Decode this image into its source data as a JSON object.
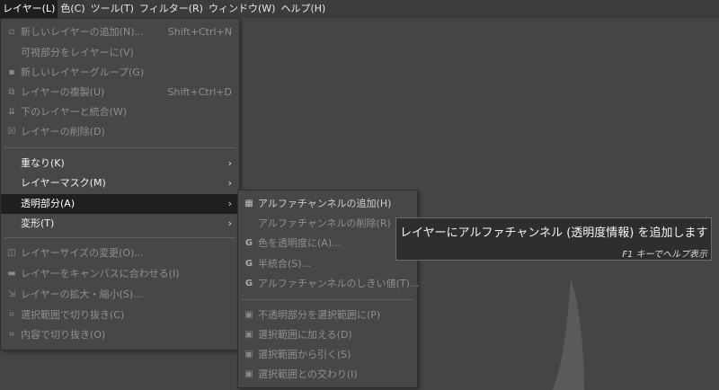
{
  "menubar": [
    {
      "label": "レイヤー(L)",
      "active": true
    },
    {
      "label": "色(C)"
    },
    {
      "label": "ツール(T)"
    },
    {
      "label": "フィルター(R)"
    },
    {
      "label": "ウィンドウ(W)"
    },
    {
      "label": "ヘルプ(H)"
    }
  ],
  "layer_menu": {
    "new_layer": {
      "label": "新しいレイヤーの追加(N)...",
      "shortcut": "Shift+Ctrl+N",
      "icon": "new-layer-icon"
    },
    "new_from_visible": {
      "label": "可視部分をレイヤーに(V)"
    },
    "new_layer_group": {
      "label": "新しいレイヤーグループ(G)",
      "icon": "folder-icon"
    },
    "duplicate": {
      "label": "レイヤーの複製(U)",
      "shortcut": "Shift+Ctrl+D",
      "icon": "duplicate-icon"
    },
    "merge_down": {
      "label": "下のレイヤーと統合(W)",
      "icon": "merge-down-icon"
    },
    "delete": {
      "label": "レイヤーの削除(D)",
      "icon": "delete-icon"
    },
    "stack": {
      "label": "重なり(K)"
    },
    "mask": {
      "label": "レイヤーマスク(M)"
    },
    "transparency": {
      "label": "透明部分(A)"
    },
    "transform": {
      "label": "変形(T)"
    },
    "boundary_size": {
      "label": "レイヤーサイズの変更(O)...",
      "icon": "resize-icon"
    },
    "layer_to_image": {
      "label": "レイヤーをキャンバスに合わせる(I)",
      "icon": "fit-canvas-icon"
    },
    "scale": {
      "label": "レイヤーの拡大・縮小(S)...",
      "icon": "scale-icon"
    },
    "crop_to_selection": {
      "label": "選択範囲で切り抜き(C)",
      "icon": "crop-icon"
    },
    "crop_to_content": {
      "label": "内容で切り抜き(O)",
      "icon": "crop-content-icon"
    }
  },
  "transparency_menu": {
    "add_alpha": {
      "label": "アルファチャンネルの追加(H)",
      "icon": "checker-icon"
    },
    "remove_alpha": {
      "label": "アルファチャンネルの削除(R)"
    },
    "color_to_alpha": {
      "label": "色を透明度に(A)...",
      "icon": "gegl-icon"
    },
    "semi_flatten": {
      "label": "半統合(S)...",
      "icon": "gegl-icon"
    },
    "threshold_alpha": {
      "label": "アルファチャンネルのしきい値(T)...",
      "icon": "gegl-icon"
    },
    "alpha_to_selection": {
      "label": "不透明部分を選択範囲に(P)",
      "icon": "selection-icon"
    },
    "add_to_selection": {
      "label": "選択範囲に加える(D)",
      "icon": "selection-add-icon"
    },
    "subtract_from_selection": {
      "label": "選択範囲から引く(S)",
      "icon": "selection-subtract-icon"
    },
    "intersect_with_selection": {
      "label": "選択範囲との交わり(I)",
      "icon": "selection-intersect-icon"
    }
  },
  "tooltip": {
    "text": "レイヤーにアルファチャンネル (透明度情報) を追加します",
    "hint": "F1 キーでヘルプ表示"
  }
}
